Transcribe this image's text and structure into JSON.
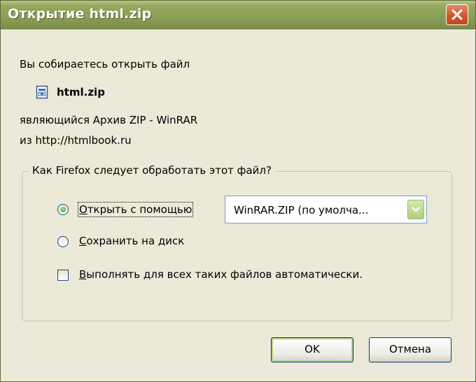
{
  "window": {
    "title": "Открытие html.zip",
    "close_icon": "close-icon"
  },
  "body": {
    "intro": "Вы собираетесь открыть файл",
    "file_name": "html.zip",
    "file_icon": "zip-file-icon",
    "type_line": "являющийся  Архив ZIP - WinRAR",
    "from_line": "из  http://htmlbook.ru"
  },
  "action_group": {
    "legend": "Как Firefox следует обработать этот файл?",
    "open_with": {
      "underlined": "О",
      "rest": "ткрыть с помощью",
      "selected": true
    },
    "app_select": {
      "value": "WinRAR.ZIP (по умолча..."
    },
    "save_to_disk": {
      "underlined": "С",
      "rest": "охранить на диск",
      "selected": false
    },
    "auto_apply": {
      "underlined": "В",
      "rest": "ыполнять для всех таких файлов автоматически.",
      "checked": false
    }
  },
  "buttons": {
    "ok": "OK",
    "cancel": "Отмена"
  },
  "colors": {
    "titlebar": "#8a9e56",
    "dialog_bg": "#ece9d8",
    "close_button": "#d2532d"
  }
}
